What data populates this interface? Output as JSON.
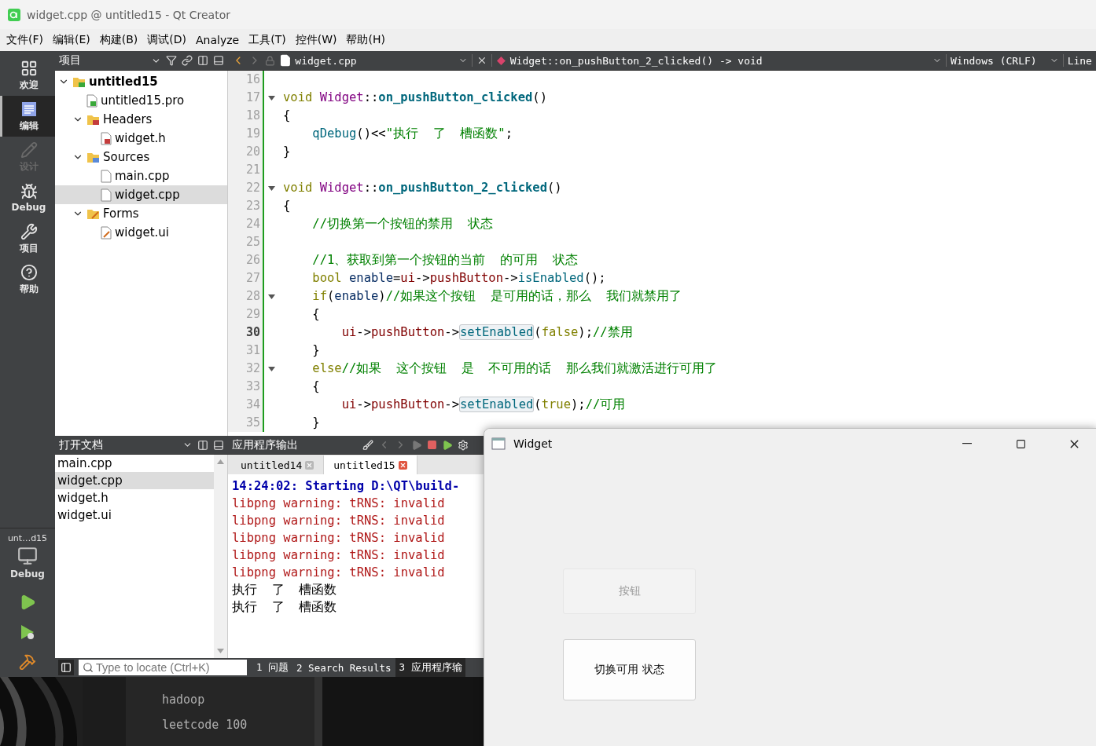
{
  "window": {
    "title": "widget.cpp @ untitled15 - Qt Creator"
  },
  "menu": [
    "文件(F)",
    "编辑(E)",
    "构建(B)",
    "调试(D)",
    "Analyze",
    "工具(T)",
    "控件(W)",
    "帮助(H)"
  ],
  "modes": [
    {
      "label": "欢迎",
      "kind": "welcome",
      "selected": false,
      "disabled": false
    },
    {
      "label": "编辑",
      "kind": "edit",
      "selected": true,
      "disabled": false
    },
    {
      "label": "设计",
      "kind": "design",
      "selected": false,
      "disabled": true
    },
    {
      "label": "Debug",
      "kind": "debug",
      "selected": false,
      "disabled": false
    },
    {
      "label": "项目",
      "kind": "projects",
      "selected": false,
      "disabled": false
    },
    {
      "label": "帮助",
      "kind": "help",
      "selected": false,
      "disabled": false
    }
  ],
  "kit": {
    "project": "unt…d15",
    "build": "Debug"
  },
  "project_pane": {
    "title": "项目",
    "tree": [
      {
        "label": "untitled15",
        "kind": "project",
        "expanded": true,
        "selected": false,
        "children": [
          {
            "label": "untitled15.pro",
            "kind": "pro",
            "selected": false
          },
          {
            "label": "Headers",
            "kind": "folder-h",
            "expanded": true,
            "selected": false,
            "children": [
              {
                "label": "widget.h",
                "kind": "h",
                "selected": false
              }
            ]
          },
          {
            "label": "Sources",
            "kind": "folder-cpp",
            "expanded": true,
            "selected": false,
            "children": [
              {
                "label": "main.cpp",
                "kind": "cpp",
                "selected": false
              },
              {
                "label": "widget.cpp",
                "kind": "cpp",
                "selected": true
              }
            ]
          },
          {
            "label": "Forms",
            "kind": "folder-ui",
            "expanded": true,
            "selected": false,
            "children": [
              {
                "label": "widget.ui",
                "kind": "ui",
                "selected": false
              }
            ]
          }
        ]
      }
    ]
  },
  "open_documents": {
    "title": "打开文档",
    "items": [
      {
        "label": "main.cpp",
        "selected": false
      },
      {
        "label": "widget.cpp",
        "selected": true
      },
      {
        "label": "widget.h",
        "selected": false
      },
      {
        "label": "widget.ui",
        "selected": false
      }
    ]
  },
  "editor": {
    "file": "widget.cpp",
    "symbol": "Widget::on_pushButton_2_clicked() -> void",
    "line_ending": "Windows (CRLF)",
    "position": "Line",
    "lines": [
      {
        "number": "16",
        "fold": false,
        "current": false
      },
      {
        "number": "17",
        "fold": true,
        "current": false,
        "tokens": [
          {
            "text": "void",
            "kind": "kw"
          },
          {
            "text": " Widget",
            "kind": "type"
          },
          {
            "text": "::",
            "kind": "punct"
          },
          {
            "text": "on_pushButton_clicked",
            "kind": "func"
          },
          {
            "text": "()",
            "kind": "punct"
          }
        ]
      },
      {
        "number": "18",
        "fold": false,
        "current": false,
        "tokens": [
          {
            "text": "{",
            "kind": "punct"
          }
        ]
      },
      {
        "number": "19",
        "fold": false,
        "current": false,
        "tokens": [
          {
            "text": "    qDebug",
            "kind": "call"
          },
          {
            "text": "()<<",
            "kind": "punct"
          },
          {
            "text": "\"执行  了  槽函数\"",
            "kind": "str"
          },
          {
            "text": ";",
            "kind": "punct"
          }
        ]
      },
      {
        "number": "20",
        "fold": false,
        "current": false,
        "tokens": [
          {
            "text": "}",
            "kind": "punct"
          }
        ]
      },
      {
        "number": "21",
        "fold": false,
        "current": false
      },
      {
        "number": "22",
        "fold": true,
        "current": false,
        "tokens": [
          {
            "text": "void",
            "kind": "kw"
          },
          {
            "text": " Widget",
            "kind": "type"
          },
          {
            "text": "::",
            "kind": "punct"
          },
          {
            "text": "on_pushButton_2_clicked",
            "kind": "func"
          },
          {
            "text": "()",
            "kind": "punct"
          }
        ]
      },
      {
        "number": "23",
        "fold": false,
        "current": false,
        "tokens": [
          {
            "text": "{",
            "kind": "punct"
          }
        ]
      },
      {
        "number": "24",
        "fold": false,
        "current": false,
        "tokens": [
          {
            "text": "    //切换第一个按钮的禁用  状态",
            "kind": "comment"
          }
        ]
      },
      {
        "number": "25",
        "fold": false,
        "current": false
      },
      {
        "number": "26",
        "fold": false,
        "current": false,
        "tokens": [
          {
            "text": "    //1、获取到第一个按钮的当前  的可用  状态",
            "kind": "comment"
          }
        ]
      },
      {
        "number": "27",
        "fold": false,
        "current": false,
        "tokens": [
          {
            "text": "    bool",
            "kind": "kw"
          },
          {
            "text": " enable",
            "kind": "var"
          },
          {
            "text": "=",
            "kind": "punct"
          },
          {
            "text": "ui",
            "kind": "member"
          },
          {
            "text": "->",
            "kind": "punct"
          },
          {
            "text": "pushButton",
            "kind": "member"
          },
          {
            "text": "->",
            "kind": "punct"
          },
          {
            "text": "isEnabled",
            "kind": "call"
          },
          {
            "text": "();",
            "kind": "punct"
          }
        ]
      },
      {
        "number": "28",
        "fold": true,
        "current": false,
        "tokens": [
          {
            "text": "    if",
            "kind": "kw"
          },
          {
            "text": "(",
            "kind": "punct"
          },
          {
            "text": "enable",
            "kind": "var"
          },
          {
            "text": ")",
            "kind": "punct"
          },
          {
            "text": "//如果这个按钮  是可用的话，那么  我们就禁用了",
            "kind": "comment"
          }
        ]
      },
      {
        "number": "29",
        "fold": false,
        "current": false,
        "tokens": [
          {
            "text": "    {",
            "kind": "punct"
          }
        ]
      },
      {
        "number": "30",
        "fold": false,
        "current": true,
        "tokens": [
          {
            "text": "        ui",
            "kind": "member"
          },
          {
            "text": "->",
            "kind": "punct"
          },
          {
            "text": "pushButton",
            "kind": "member"
          },
          {
            "text": "->",
            "kind": "punct"
          },
          {
            "text": "setEnabled",
            "kind": "hl"
          },
          {
            "text": "(",
            "kind": "punct"
          },
          {
            "text": "false",
            "kind": "kw"
          },
          {
            "text": ");",
            "kind": "punct"
          },
          {
            "text": "//禁用",
            "kind": "comment"
          }
        ]
      },
      {
        "number": "31",
        "fold": false,
        "current": false,
        "tokens": [
          {
            "text": "    }",
            "kind": "punct"
          }
        ]
      },
      {
        "number": "32",
        "fold": true,
        "current": false,
        "tokens": [
          {
            "text": "    else",
            "kind": "kw"
          },
          {
            "text": "//如果  这个按钮  是  不可用的话  那么我们就激活进行可用了",
            "kind": "comment"
          }
        ]
      },
      {
        "number": "33",
        "fold": false,
        "current": false,
        "tokens": [
          {
            "text": "    {",
            "kind": "punct"
          }
        ]
      },
      {
        "number": "34",
        "fold": false,
        "current": false,
        "tokens": [
          {
            "text": "        ui",
            "kind": "member"
          },
          {
            "text": "->",
            "kind": "punct"
          },
          {
            "text": "pushButton",
            "kind": "member"
          },
          {
            "text": "->",
            "kind": "punct"
          },
          {
            "text": "setEnabled",
            "kind": "hl"
          },
          {
            "text": "(",
            "kind": "punct"
          },
          {
            "text": "true",
            "kind": "kw"
          },
          {
            "text": ");",
            "kind": "punct"
          },
          {
            "text": "//可用",
            "kind": "comment"
          }
        ]
      },
      {
        "number": "35",
        "fold": false,
        "current": false,
        "tokens": [
          {
            "text": "    }",
            "kind": "punct"
          }
        ]
      }
    ]
  },
  "output": {
    "title": "应用程序输出",
    "tabs": [
      {
        "label": "untitled14",
        "selected": false
      },
      {
        "label": "untitled15",
        "selected": true
      }
    ],
    "lines": [
      {
        "text": "14:24:02: Starting D:\\QT\\build-",
        "kind": "info"
      },
      {
        "text": "libpng warning: tRNS: invalid",
        "kind": "warning"
      },
      {
        "text": "libpng warning: tRNS: invalid",
        "kind": "warning"
      },
      {
        "text": "libpng warning: tRNS: invalid",
        "kind": "warning"
      },
      {
        "text": "libpng warning: tRNS: invalid",
        "kind": "warning"
      },
      {
        "text": "libpng warning: tRNS: invalid",
        "kind": "warning"
      },
      {
        "text": "执行  了  槽函数",
        "kind": "plain"
      },
      {
        "text": "执行  了  槽函数",
        "kind": "plain"
      }
    ]
  },
  "status_bar": {
    "search": {
      "placeholder": "Type to locate (Ctrl+K)"
    },
    "tabs": [
      {
        "label": "1 问题",
        "selected": false
      },
      {
        "label": "2 Search Results",
        "selected": false
      },
      {
        "label": "3 应用程序输",
        "selected": true
      }
    ]
  },
  "desktop": {
    "items": [
      "hadoop",
      "leetcode 100"
    ]
  },
  "widget_window": {
    "title": "Widget",
    "buttons": [
      {
        "label": "按钮",
        "disabled": true
      },
      {
        "label": "切换可用  状态",
        "disabled": false
      }
    ]
  }
}
